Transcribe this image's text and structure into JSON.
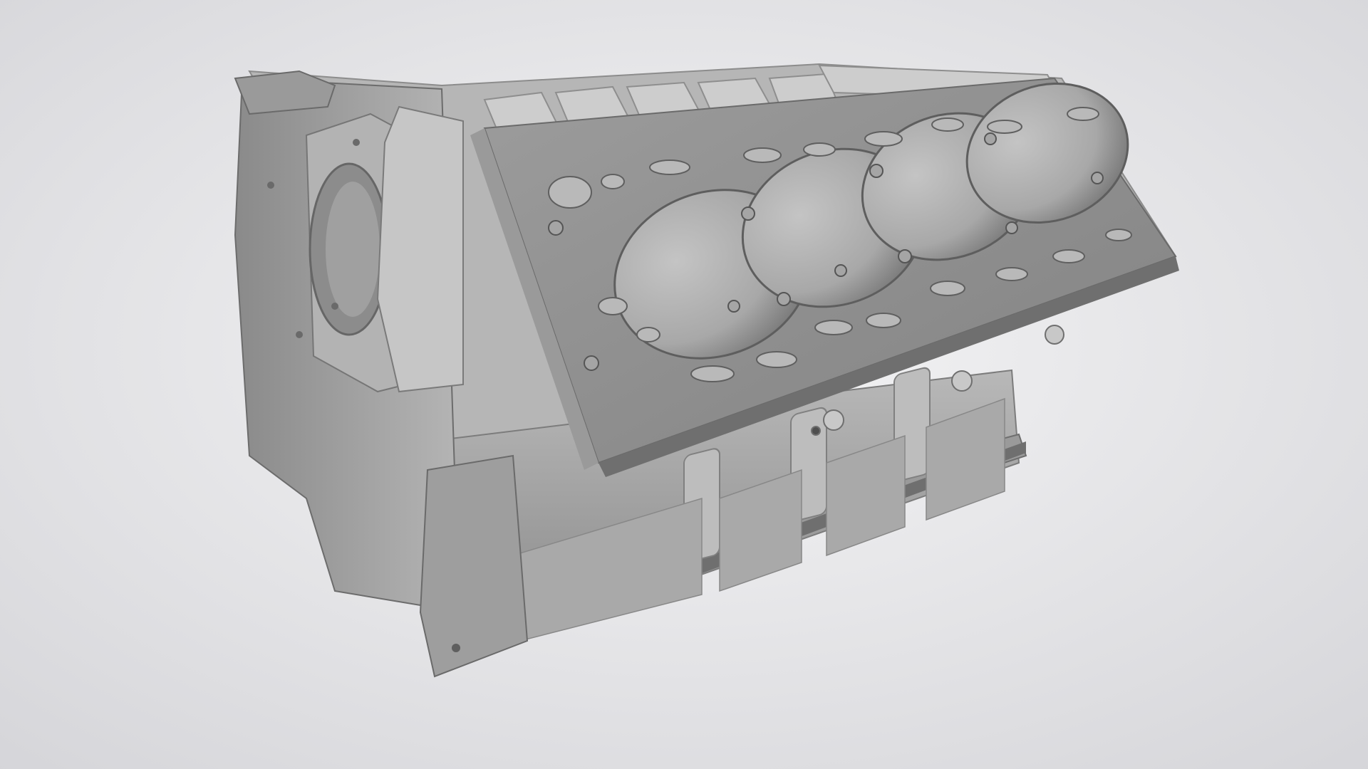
{
  "scene": {
    "subject": "engine-block",
    "cylinders_visible": 4,
    "colors": {
      "background_center": "#f4f4f5",
      "background_edge": "#d6d6da",
      "metal_light": "#c9c9c9",
      "metal_mid": "#a9a9a9",
      "metal_dark": "#7a7a7a",
      "deck_surface": "#8f8f8f",
      "bore_shade": "#b5b5b5"
    }
  }
}
